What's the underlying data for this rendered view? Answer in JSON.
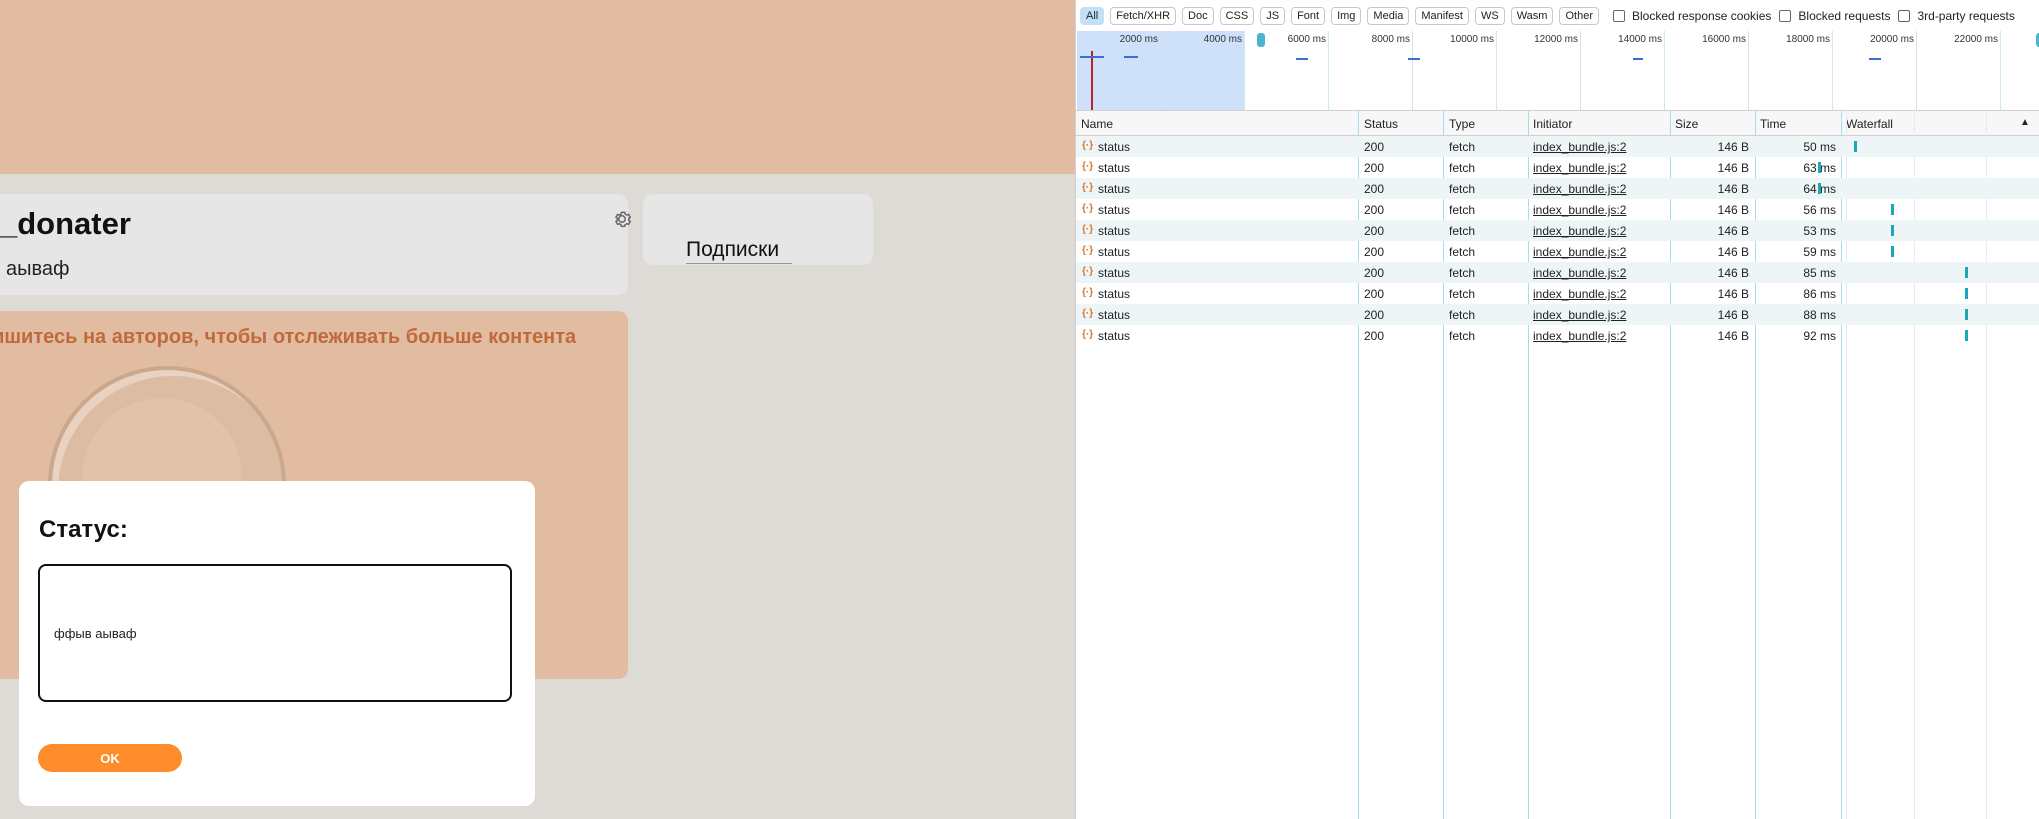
{
  "page": {
    "profile_name": "_donater",
    "profile_status": "аываф",
    "subscriptions_label": "Подписки",
    "promo_text": "пишитесь на авторов, чтобы отслеживать больше контента"
  },
  "modal": {
    "title": "Статус:",
    "input_value": "ффыв аываф",
    "ok_label": "OK"
  },
  "devtools": {
    "filters": [
      {
        "label": "All",
        "active": true
      },
      {
        "label": "Fetch/XHR"
      },
      {
        "label": "Doc"
      },
      {
        "label": "CSS"
      },
      {
        "label": "JS"
      },
      {
        "label": "Font"
      },
      {
        "label": "Img"
      },
      {
        "label": "Media"
      },
      {
        "label": "Manifest"
      },
      {
        "label": "WS"
      },
      {
        "label": "Wasm"
      },
      {
        "label": "Other"
      }
    ],
    "checkboxes": [
      "Blocked response cookies",
      "Blocked requests",
      "3rd-party requests"
    ],
    "timeline_ticks": [
      "2000 ms",
      "4000 ms",
      "6000 ms",
      "8000 ms",
      "10000 ms",
      "12000 ms",
      "14000 ms",
      "16000 ms",
      "18000 ms",
      "20000 ms",
      "22000 ms"
    ],
    "columns": {
      "name": "Name",
      "status": "Status",
      "type": "Type",
      "initiator": "Initiator",
      "size": "Size",
      "time": "Time",
      "waterfall": "Waterfall",
      "sort_icon": "▲"
    },
    "rows": [
      {
        "name": "status",
        "status": "200",
        "type": "fetch",
        "initiator": "index_bundle.js:2",
        "size": "146 B",
        "time": "50 ms"
      },
      {
        "name": "status",
        "status": "200",
        "type": "fetch",
        "initiator": "index_bundle.js:2",
        "size": "146 B",
        "time": "63 ms"
      },
      {
        "name": "status",
        "status": "200",
        "type": "fetch",
        "initiator": "index_bundle.js:2",
        "size": "146 B",
        "time": "64 ms"
      },
      {
        "name": "status",
        "status": "200",
        "type": "fetch",
        "initiator": "index_bundle.js:2",
        "size": "146 B",
        "time": "56 ms"
      },
      {
        "name": "status",
        "status": "200",
        "type": "fetch",
        "initiator": "index_bundle.js:2",
        "size": "146 B",
        "time": "53 ms"
      },
      {
        "name": "status",
        "status": "200",
        "type": "fetch",
        "initiator": "index_bundle.js:2",
        "size": "146 B",
        "time": "59 ms"
      },
      {
        "name": "status",
        "status": "200",
        "type": "fetch",
        "initiator": "index_bundle.js:2",
        "size": "146 B",
        "time": "85 ms"
      },
      {
        "name": "status",
        "status": "200",
        "type": "fetch",
        "initiator": "index_bundle.js:2",
        "size": "146 B",
        "time": "86 ms"
      },
      {
        "name": "status",
        "status": "200",
        "type": "fetch",
        "initiator": "index_bundle.js:2",
        "size": "146 B",
        "time": "88 ms"
      },
      {
        "name": "status",
        "status": "200",
        "type": "fetch",
        "initiator": "index_bundle.js:2",
        "size": "146 B",
        "time": "92 ms"
      }
    ]
  }
}
